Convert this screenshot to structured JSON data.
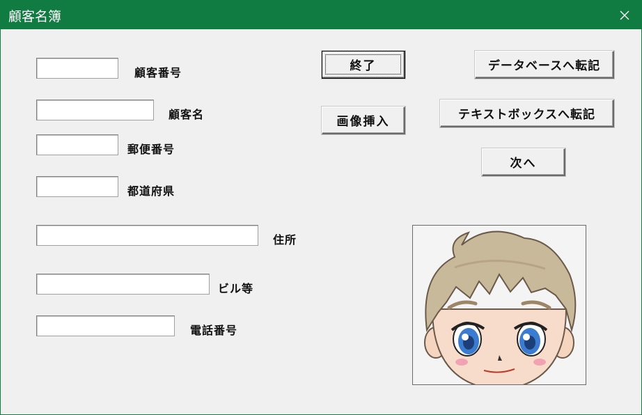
{
  "window": {
    "title": "顧客名簿",
    "titlebar_color": "#107c41",
    "close_icon": "close-icon"
  },
  "form": {
    "fields": [
      {
        "id": "customer_no",
        "label": "顧客番号",
        "value": ""
      },
      {
        "id": "customer_name",
        "label": "顧客名",
        "value": ""
      },
      {
        "id": "postal_code",
        "label": "郵便番号",
        "value": ""
      },
      {
        "id": "prefecture",
        "label": "都道府県",
        "value": ""
      },
      {
        "id": "address",
        "label": "住所",
        "value": ""
      },
      {
        "id": "building",
        "label": "ビル等",
        "value": ""
      },
      {
        "id": "phone",
        "label": "電話番号",
        "value": ""
      }
    ]
  },
  "buttons": {
    "exit": "終了",
    "insert_image": "画像挿入",
    "to_database": "データベースへ転記",
    "to_textbox": "テキストボックスへ転記",
    "next": "次へ"
  },
  "picture": {
    "icon": "customer-photo-boy-illustration"
  }
}
